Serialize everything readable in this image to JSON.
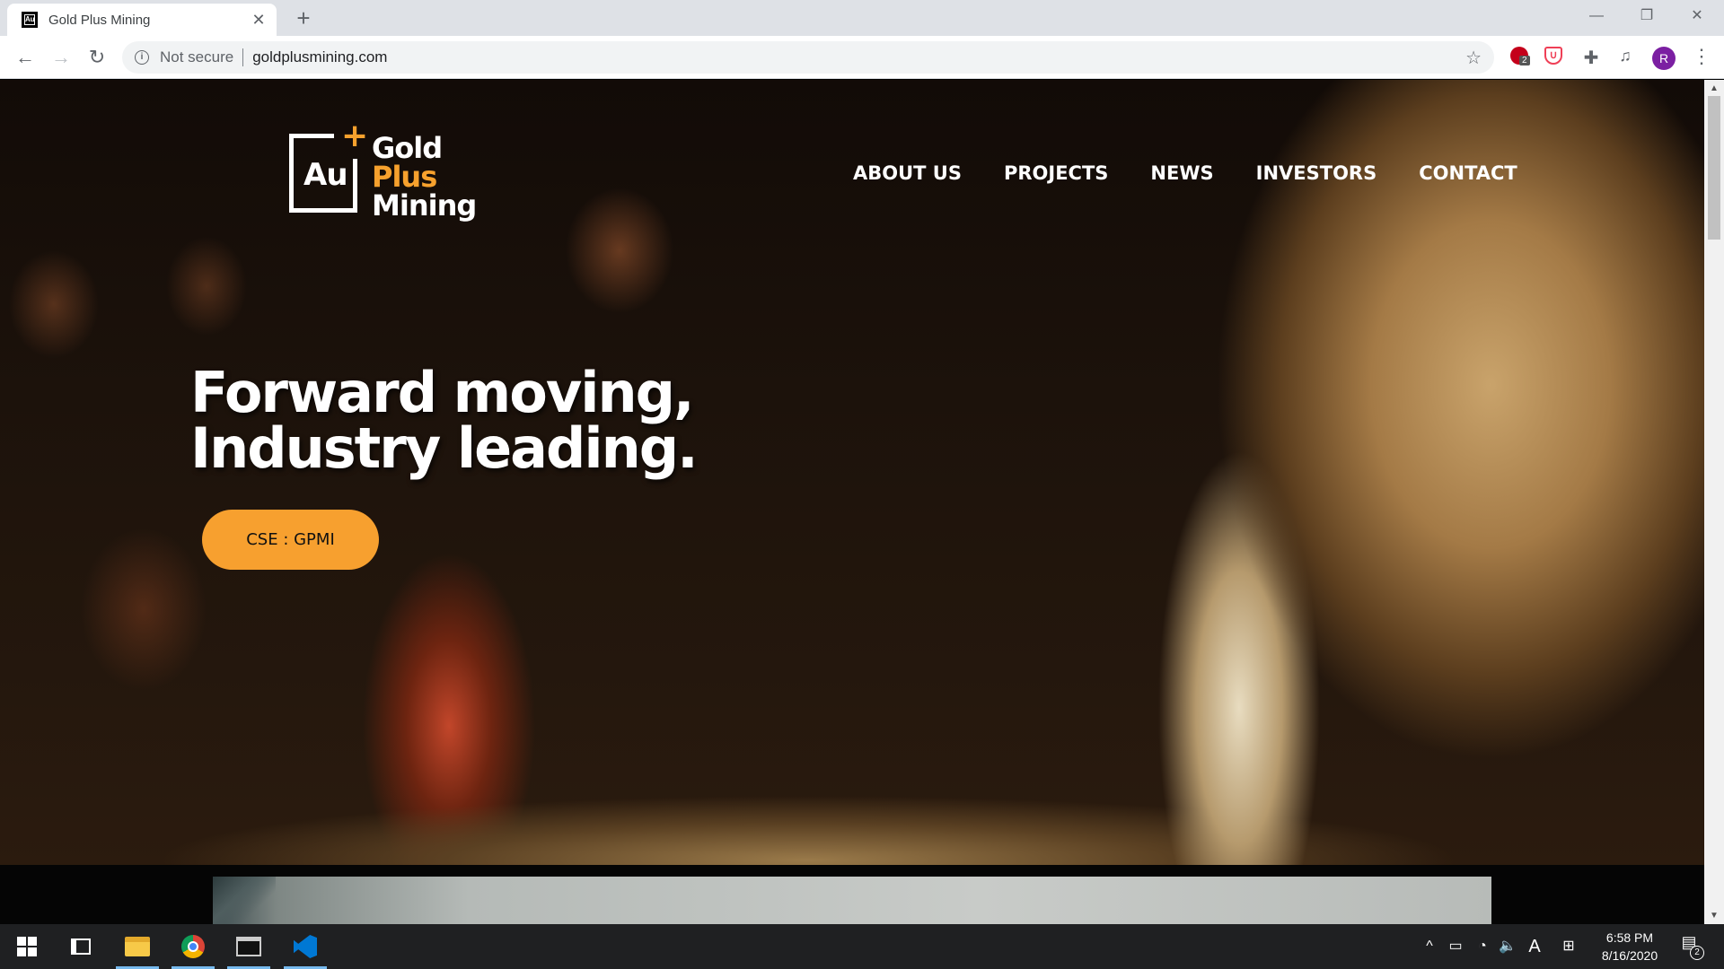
{
  "browser": {
    "tab_title": "Gold Plus Mining",
    "tab_close": "✕",
    "new_tab": "+",
    "window_min": "—",
    "window_restore": "❐",
    "window_close": "✕",
    "security_label": "Not secure",
    "url": "goldplusmining.com",
    "profile_initial": "R",
    "ublock_badge": "2"
  },
  "site": {
    "logo": {
      "symbol": "Au",
      "plus": "+",
      "word1": "Gold",
      "word2": "Plus",
      "word3": "Mining"
    },
    "nav": [
      "ABOUT US",
      "PROJECTS",
      "NEWS",
      "INVESTORS",
      "CONTACT"
    ],
    "headline_line1": "Forward moving,",
    "headline_line2": "Industry leading.",
    "cta_label": "CSE : GPMI"
  },
  "taskbar": {
    "time": "6:58 PM",
    "date": "8/16/2020",
    "notification_count": "2",
    "ime_label": "A"
  },
  "colors": {
    "accent_orange": "#f7a02f",
    "tab_bar": "#dee1e6",
    "taskbar": "#1f2022"
  }
}
